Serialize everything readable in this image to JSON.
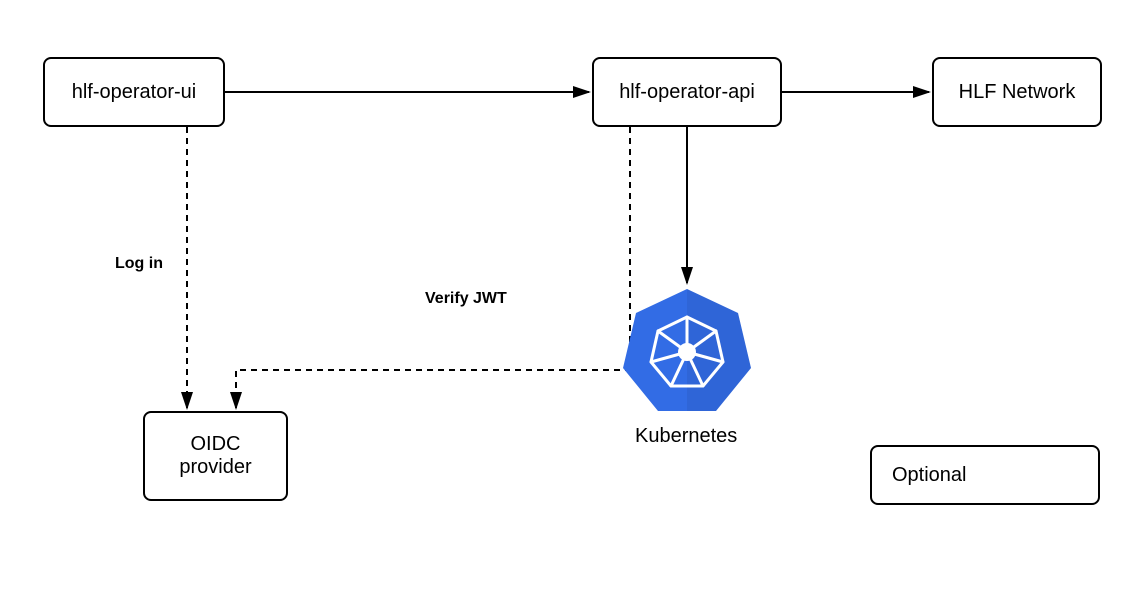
{
  "nodes": {
    "ui": "hlf-operator-ui",
    "api": "hlf-operator-api",
    "hlf_network": "HLF Network",
    "oidc": "OIDC provider",
    "kubernetes": "Kubernetes"
  },
  "edges": {
    "login": "Log in",
    "verify_jwt": "Verify JWT"
  },
  "legend": {
    "optional": "Optional"
  },
  "colors": {
    "kubernetes_blue": "#326CE5",
    "line": "#000000"
  }
}
